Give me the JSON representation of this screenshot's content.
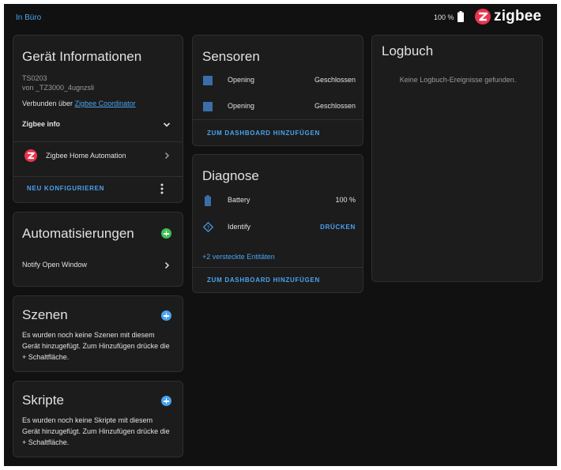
{
  "topbar": {
    "breadcrumb": "In Büro",
    "battery_text": "100 %",
    "brand_name": "zigbee",
    "colors": {
      "accent": "#4aa3f0",
      "brand_red": "#e8344e",
      "green": "#40c057"
    }
  },
  "device_info": {
    "title": "Gerät Informationen",
    "model": "TS0203",
    "manufacturer": "von _TZ3000_4ugnzsli",
    "connected_prefix": "Verbunden über",
    "connected_link": "Zigbee Coordinator",
    "zigbee_info_label": "Zigbee info",
    "integration_label": "Zigbee Home Automation",
    "reconfigure_label": "NEU KONFIGURIEREN"
  },
  "automations": {
    "title": "Automatisierungen",
    "items": [
      {
        "label": "Notify Open Window"
      }
    ]
  },
  "scenes": {
    "title": "Szenen",
    "empty_text": "Es wurden noch keine Szenen mit diesem Gerät hinzugefügt. Zum Hinzufügen drücke die + Schaltfläche."
  },
  "scripts": {
    "title": "Skripte",
    "empty_text": "Es wurden noch keine Skripte mit diesem Gerät hinzugefügt. Zum Hinzufügen drücke die + Schaltfläche."
  },
  "sensors": {
    "title": "Sensoren",
    "rows": [
      {
        "name": "Opening",
        "state": "Geschlossen",
        "icon": "door-sensor-icon"
      },
      {
        "name": "Opening",
        "state": "Geschlossen",
        "icon": "door-sensor-icon"
      }
    ],
    "add_label": "ZUM DASHBOARD HINZUFÜGEN"
  },
  "diagnose": {
    "title": "Diagnose",
    "battery_label": "Battery",
    "battery_value": "100 %",
    "identify_label": "Identify",
    "identify_action": "DRÜCKEN",
    "hidden_entities": "+2 versteckte Entitäten",
    "add_label": "ZUM DASHBOARD HINZUFÜGEN"
  },
  "logbook": {
    "title": "Logbuch",
    "empty_text": "Keine Logbuch-Ereignisse gefunden."
  }
}
